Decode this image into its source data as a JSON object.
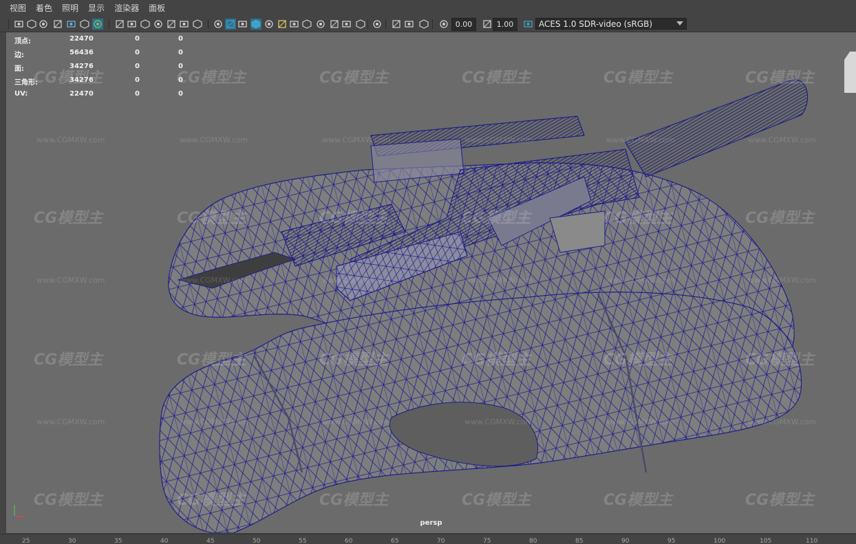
{
  "menu": [
    "视图",
    "着色",
    "照明",
    "显示",
    "渲染器",
    "面板"
  ],
  "toolbar": {
    "icons": [
      "camera-select-icon",
      "camera-lock-icon",
      "camera-attributes-icon",
      "bookmark-icon",
      "image-plane-icon",
      "2d-pan-zoom-icon",
      "grease-pencil-icon",
      "grid-icon",
      "film-gate-icon",
      "resolution-gate-icon",
      "gate-mask-icon",
      "field-chart-icon",
      "safe-action-icon",
      "safe-title-icon",
      "wireframe-icon",
      "smooth-shade-icon",
      "default-material-icon",
      "wireframe-on-shaded-icon",
      "textured-icon",
      "lights-icon",
      "shadows-icon",
      "screen-space-ao-icon",
      "motion-blur-icon",
      "multisample-aa-icon",
      "depth-of-field-icon",
      "isolate-select-icon",
      "xray-icon",
      "xray-joints-icon",
      "backface-icon",
      "exposure-icon",
      "gamma-icon",
      "color-management-icon"
    ],
    "exposure_value": "0.00",
    "gamma_value": "1.00",
    "color_space": "ACES 1.0 SDR-video (sRGB)"
  },
  "hud": {
    "rows": [
      {
        "label": "顶点:",
        "v1": "22470",
        "v2": "0",
        "v3": "0"
      },
      {
        "label": "边:",
        "v1": "56436",
        "v2": "0",
        "v3": "0"
      },
      {
        "label": "面:",
        "v1": "34276",
        "v2": "0",
        "v3": "0"
      },
      {
        "label": "三角形:",
        "v1": "34276",
        "v2": "0",
        "v3": "0"
      },
      {
        "label": "UV:",
        "v1": "22470",
        "v2": "0",
        "v3": "0"
      }
    ]
  },
  "viewport": {
    "camera_label": "persp"
  },
  "watermark": {
    "logo": "CG模型主",
    "url": "www.CGMXW.com"
  },
  "ruler": {
    "ticks": [
      "25",
      "30",
      "35",
      "40",
      "45",
      "50",
      "55",
      "60",
      "65",
      "70",
      "75",
      "80",
      "85",
      "90",
      "95",
      "100",
      "105",
      "110"
    ]
  },
  "colors": {
    "viewport_bg": "#6b6b6b",
    "wire": "#1c1c8a",
    "mesh_fill": "#7e7e7e",
    "active_icon": "#3fa3c8"
  }
}
